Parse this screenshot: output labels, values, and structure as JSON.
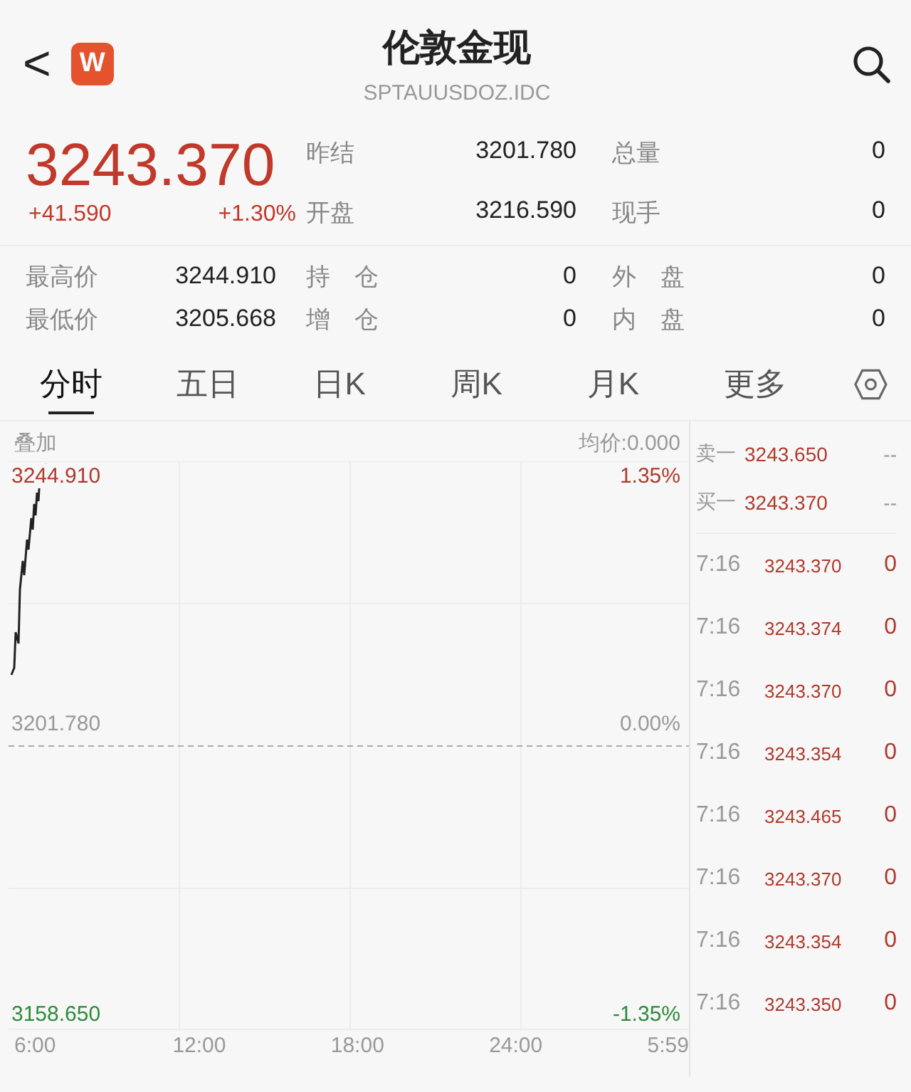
{
  "header": {
    "title": "伦敦金现",
    "code": "SPTAUUSDOZ.IDC",
    "back": "<",
    "logo": "W"
  },
  "quote": {
    "price": "3243.370",
    "change": "+41.590",
    "percent": "+1.30%"
  },
  "stats_top": [
    {
      "label": "昨结",
      "value": "3201.780"
    },
    {
      "label": "总量",
      "value": "0"
    },
    {
      "label": "开盘",
      "value": "3216.590"
    },
    {
      "label": "现手",
      "value": "0"
    }
  ],
  "stats_bottom": [
    {
      "label": "最高价",
      "value": "3244.910"
    },
    {
      "label": "持　仓",
      "value": "0"
    },
    {
      "label": "外　盘",
      "value": "0"
    },
    {
      "label": "最低价",
      "value": "3205.668"
    },
    {
      "label": "增　仓",
      "value": "0"
    },
    {
      "label": "内　盘",
      "value": "0"
    }
  ],
  "tabs": [
    {
      "label": "分时",
      "selected": true
    },
    {
      "label": "五日",
      "selected": false
    },
    {
      "label": "日K",
      "selected": false
    },
    {
      "label": "周K",
      "selected": false
    },
    {
      "label": "月K",
      "selected": false
    },
    {
      "label": "更多",
      "selected": false
    }
  ],
  "chart": {
    "overlay": "叠加",
    "avg": "均价:0.000",
    "high": "3244.910",
    "high_pct": "1.35%",
    "mid": "3201.780",
    "mid_pct": "0.00%",
    "low": "3158.650",
    "low_pct": "-1.35%",
    "xlabels": [
      "6:00",
      "12:00",
      "18:00",
      "24:00",
      "5:59"
    ]
  },
  "orderbook": [
    {
      "label": "卖一",
      "price": "3243.650",
      "volume": "--"
    },
    {
      "label": "买一",
      "price": "3243.370",
      "volume": "--"
    }
  ],
  "ticks": [
    {
      "time": "7:16",
      "price": "3243.370",
      "volume": "0"
    },
    {
      "time": "7:16",
      "price": "3243.374",
      "volume": "0"
    },
    {
      "time": "7:16",
      "price": "3243.370",
      "volume": "0"
    },
    {
      "time": "7:16",
      "price": "3243.354",
      "volume": "0"
    },
    {
      "time": "7:16",
      "price": "3243.465",
      "volume": "0"
    },
    {
      "time": "7:16",
      "price": "3243.370",
      "volume": "0"
    },
    {
      "time": "7:16",
      "price": "3243.354",
      "volume": "0"
    },
    {
      "time": "7:16",
      "price": "3243.350",
      "volume": "0"
    }
  ]
}
